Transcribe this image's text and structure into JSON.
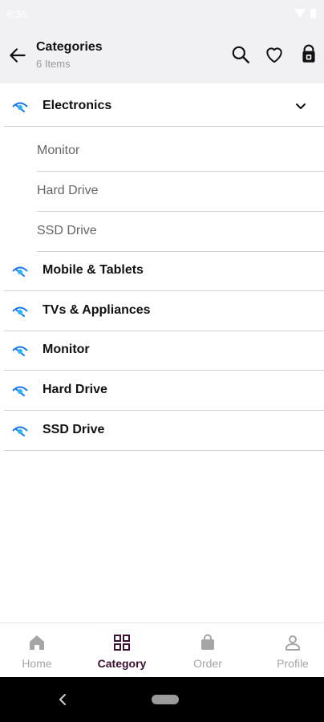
{
  "status_bar": {
    "time": "8:36"
  },
  "app_bar": {
    "title": "Categories",
    "subtitle": "6 Items",
    "icons": [
      "back-arrow-icon",
      "search-icon",
      "heart-icon",
      "shopping-bag-icon"
    ]
  },
  "categories": [
    {
      "label": "Electronics",
      "expanded": true,
      "icon": "eye-icon"
    },
    {
      "label": "Mobile & Tablets",
      "icon": "eye-icon"
    },
    {
      "label": "TVs & Appliances",
      "icon": "eye-icon"
    },
    {
      "label": "Monitor",
      "icon": "eye-icon"
    },
    {
      "label": "Hard Drive",
      "icon": "eye-icon"
    },
    {
      "label": "SSD Drive",
      "icon": "eye-icon"
    }
  ],
  "subcategories": [
    {
      "label": "Monitor"
    },
    {
      "label": "Hard Drive"
    },
    {
      "label": "SSD Drive"
    }
  ],
  "bottom_nav": [
    {
      "label": "Home",
      "icon": "home-icon",
      "active": false
    },
    {
      "label": "Category",
      "icon": "grid-icon",
      "active": true
    },
    {
      "label": "Order",
      "icon": "shopping-bag-icon",
      "active": false
    },
    {
      "label": "Profile",
      "icon": "person-icon",
      "active": false
    }
  ],
  "colors": {
    "app_bar_bg": "#f1f1f3",
    "active_nav": "#3b1030",
    "inactive_nav": "#a5a5a5",
    "category_icon_blue": "#1a73e8",
    "category_icon_cyan": "#29b6f6"
  }
}
